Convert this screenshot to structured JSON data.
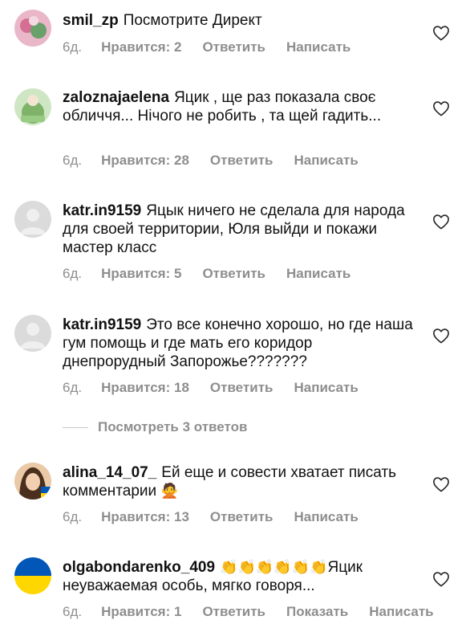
{
  "comments": [
    {
      "username": "smil_zp",
      "text": "Посмотрите Директ",
      "age": "6д.",
      "likes": "Нравится: 2",
      "reply": "Ответить",
      "message": "Написать"
    },
    {
      "username": "zaloznajaelena",
      "text": "Яцик , ще раз показала своє обличчя... Нічого не робить , та щей гадить...",
      "age": "6д.",
      "likes": "Нравится: 28",
      "reply": "Ответить",
      "message": "Написать"
    },
    {
      "username": "katr.in9159",
      "text": "Яцык ничего не сделала для народа для своей территории, Юля выйди и покажи мастер класс",
      "age": "6д.",
      "likes": "Нравится: 5",
      "reply": "Ответить",
      "message": "Написать"
    },
    {
      "username": "katr.in9159",
      "text": "Это все конечно хорошо, но где наша гум помощь и где мать его коридор днепрорудный Запорожье???????",
      "age": "6д.",
      "likes": "Нравится: 18",
      "reply": "Ответить",
      "message": "Написать"
    },
    {
      "username": "alina_14_07_",
      "text": "Ей еще и совести хватает писать комментарии",
      "emoji": "🙅",
      "age": "6д.",
      "likes": "Нравится: 13",
      "reply": "Ответить",
      "message": "Написать"
    },
    {
      "username": "olgabondarenko_409",
      "emoji": "👏👏👏👏👏👏",
      "text": "Яцик неуважаемая особь, мягко говоря...",
      "age": "6д.",
      "likes": "Нравится: 1",
      "reply": "Ответить",
      "show": "Показать",
      "message": "Написать"
    }
  ],
  "view_replies": "Посмотреть 3 ответов",
  "colors": {
    "text": "#111111",
    "meta": "#8e8e8e",
    "flag_blue": "#0057b7",
    "flag_yellow": "#ffd700"
  }
}
